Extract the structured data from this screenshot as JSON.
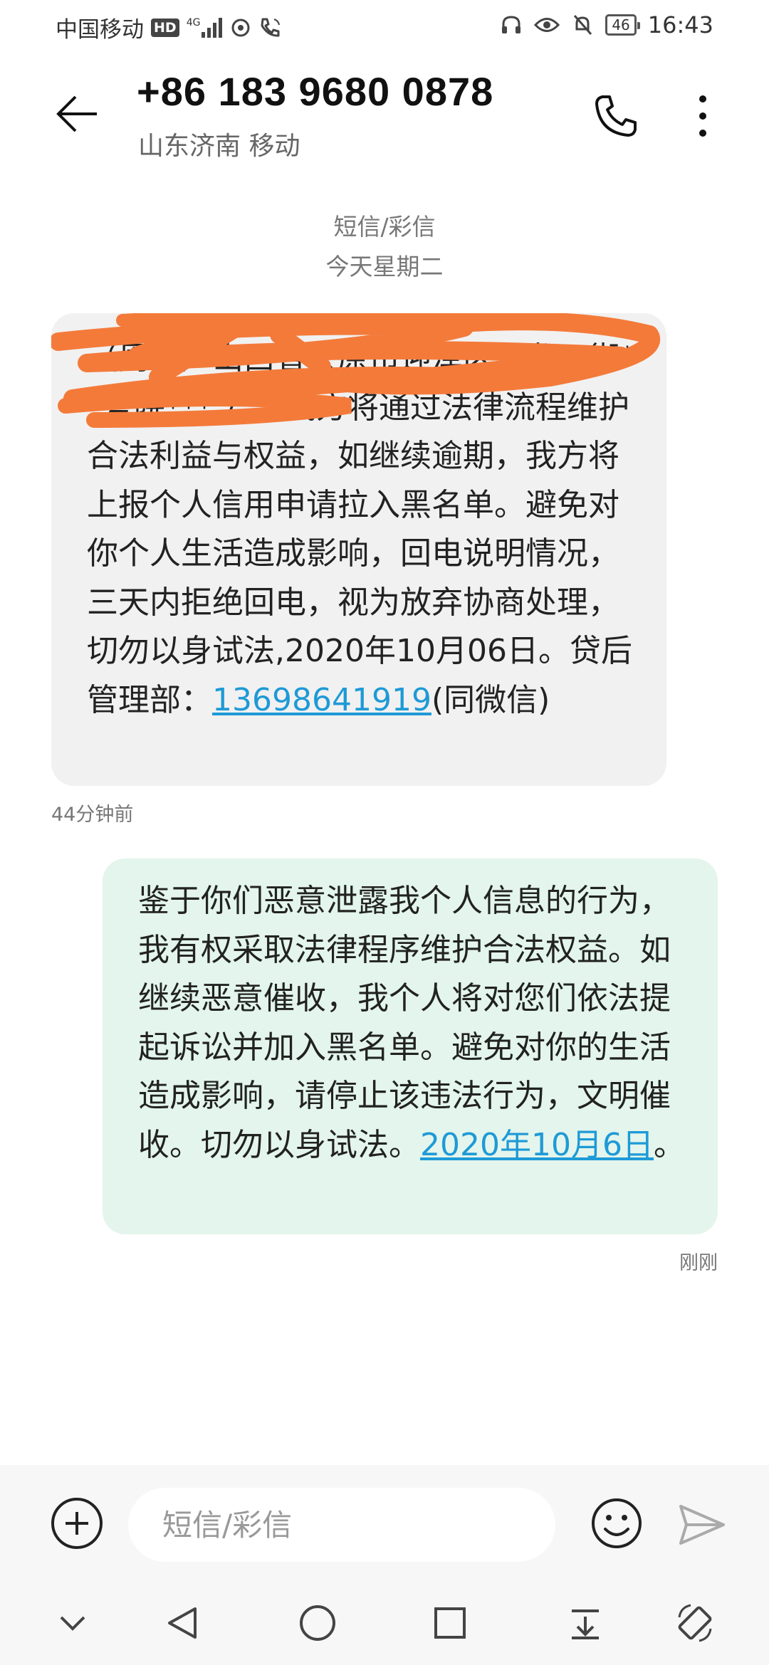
{
  "status_bar": {
    "carrier": "中国移动",
    "hd": "HD",
    "network": "4G",
    "battery": "46",
    "time": "16:43"
  },
  "header": {
    "contact_number": "+86 183 9680 0878",
    "contact_location": "山东济南 移动"
  },
  "conversation": {
    "type_label": "短信/彩信",
    "date_label": "今天星期二"
  },
  "incoming_message": {
    "text_before_link": "（周某）山西省太原市迎泽区五龙口街**号院*** 号，我方将通过法律流程维护合法利益与权益，如继续逾期，我方将上报个人信用申请拉入黑名单。避免对你个人生活造成影响，回电说明情况，三天内拒绝回电，视为放弃协商处理，切勿以身试法,2020年10月06日。贷后管理部：",
    "link_text": "13698641919",
    "text_after_link": "(同微信)",
    "time": "44分钟前"
  },
  "outgoing_message": {
    "text_before_link": "鉴于你们恶意泄露我个人信息的行为，我有权采取法律程序维护合法权益。如继续恶意催收，我个人将对您们依法提起诉讼并加入黑名单。避免对你的生活造成影响，请停止该违法行为，文明催收。切勿以身试法。",
    "link_text": "2020年10月6日",
    "text_after_link": "。",
    "time": "刚刚"
  },
  "compose": {
    "placeholder": "短信/彩信"
  },
  "colors": {
    "incoming_bubble": "#f1f1f1",
    "outgoing_bubble": "#e3f5ec",
    "link": "#1e9ad6",
    "redaction": "#f47a3a"
  }
}
